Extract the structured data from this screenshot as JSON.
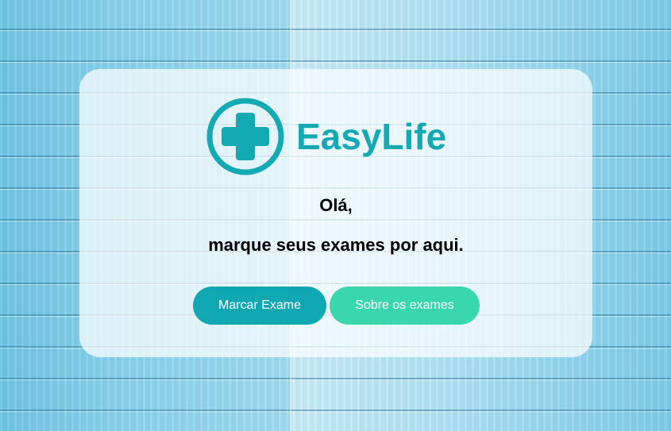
{
  "brand": {
    "name": "EasyLife",
    "icon": "medical-cross-icon",
    "color": "#14aab3"
  },
  "hero": {
    "greeting": "Olá,",
    "subtitle": "marque seus exames por aqui."
  },
  "actions": {
    "primary_label": "Marcar Exame",
    "primary_color": "#0fa8b2",
    "secondary_label": "Sobre os exames",
    "secondary_color": "#3ad6ad"
  },
  "background": {
    "description_colors": [
      "#8fd3ea",
      "#d7f1fa"
    ]
  }
}
